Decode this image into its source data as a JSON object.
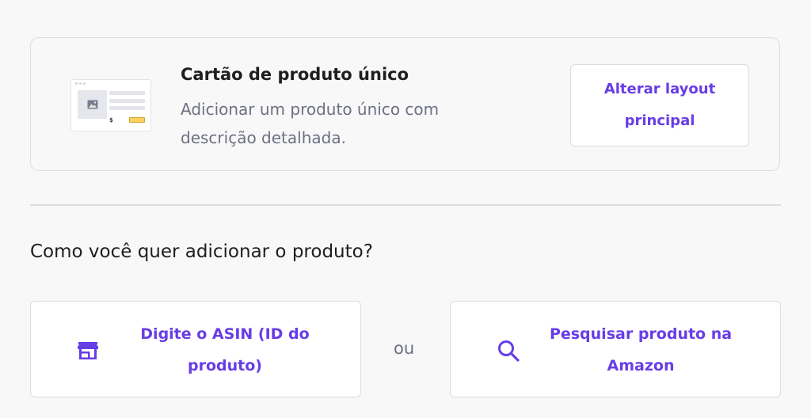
{
  "layout_card": {
    "title": "Cartão de produto único",
    "description": "Adicionar um produto único com descrição detalhada.",
    "change_button": "Alterar layout principal",
    "thumbnail_price": "$"
  },
  "add_section": {
    "question": "Como você quer adicionar o produto?",
    "asin_option": "Digite o ASIN (ID do produto)",
    "or_text": "ou",
    "search_option": "Pesquisar produto na Amazon"
  },
  "icons": {
    "thumbnail": "product-card-thumbnail-icon",
    "store": "store-icon",
    "search": "search-icon"
  },
  "colors": {
    "accent": "#673de6",
    "text": "#1d1e20",
    "muted": "#6d7081",
    "border": "#dadce0",
    "background": "#f8f8f9"
  }
}
